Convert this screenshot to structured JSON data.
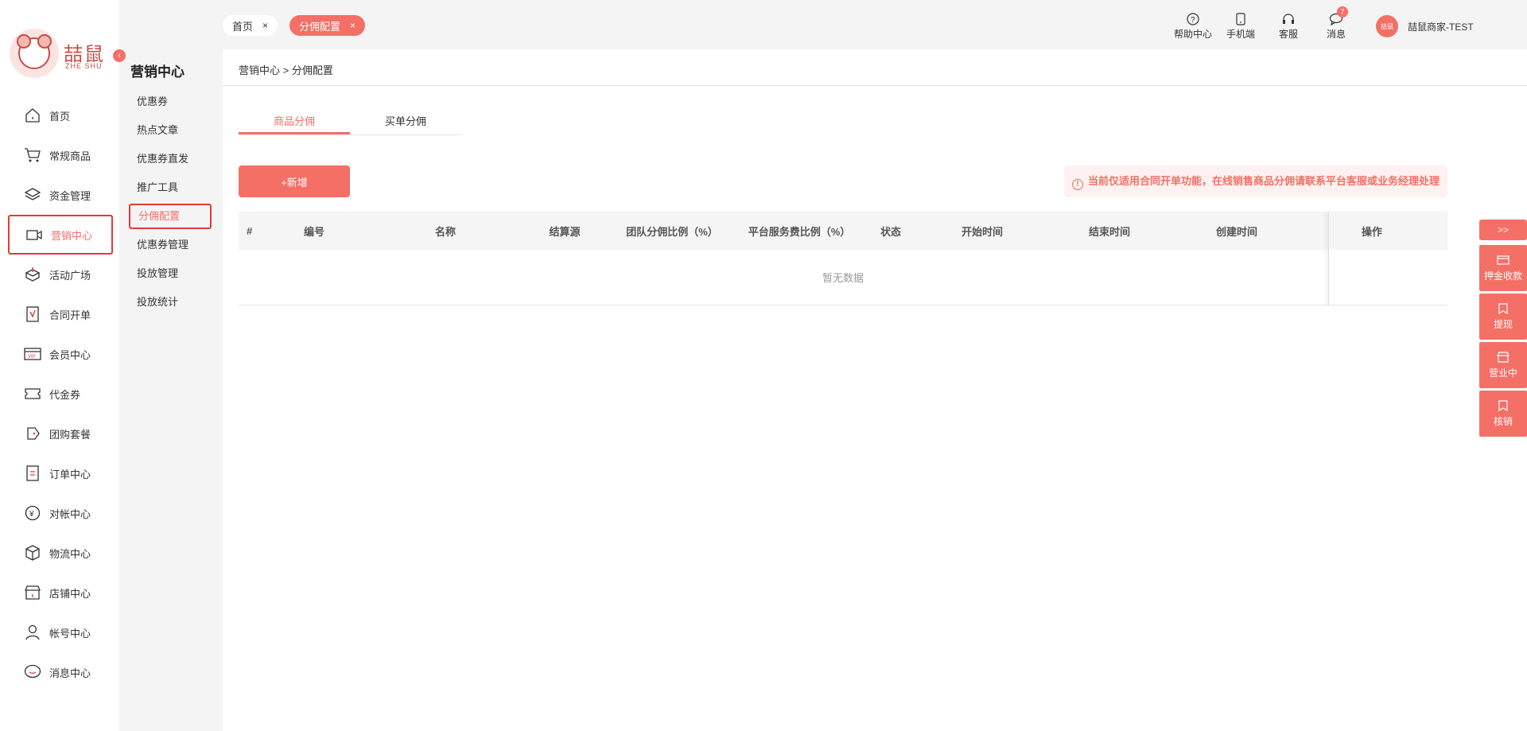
{
  "logo": {
    "text": "喆鼠",
    "sub": "ZHE SHU"
  },
  "nav": [
    {
      "label": "首页",
      "icon": "home-icon"
    },
    {
      "label": "常规商品",
      "icon": "cart-icon"
    },
    {
      "label": "资金管理",
      "icon": "layers-icon"
    },
    {
      "label": "营销中心",
      "icon": "camera-icon"
    },
    {
      "label": "活动广场",
      "icon": "box-upload-icon"
    },
    {
      "label": "合同开单",
      "icon": "contract-icon"
    },
    {
      "label": "会员中心",
      "icon": "vip-card-icon"
    },
    {
      "label": "代金券",
      "icon": "voucher-icon"
    },
    {
      "label": "团购套餐",
      "icon": "tag-icon"
    },
    {
      "label": "订单中心",
      "icon": "order-icon"
    },
    {
      "label": "对帐中心",
      "icon": "yen-icon"
    },
    {
      "label": "物流中心",
      "icon": "package-icon"
    },
    {
      "label": "店铺中心",
      "icon": "store-icon"
    },
    {
      "label": "帐号中心",
      "icon": "user-icon"
    },
    {
      "label": "消息中心",
      "icon": "message-icon"
    }
  ],
  "sub": {
    "title": "营销中心",
    "items": [
      "优惠券",
      "热点文章",
      "优惠券直发",
      "推广工具",
      "分佣配置",
      "优惠券管理",
      "投放管理",
      "投放统计"
    ]
  },
  "tabs": [
    {
      "label": "首页",
      "close": "×"
    },
    {
      "label": "分佣配置",
      "close": "×"
    }
  ],
  "topbar": {
    "help": "帮助中心",
    "mobile": "手机端",
    "service": "客服",
    "message": "消息",
    "message_count": "7",
    "avatar_text": "喆鼠",
    "user": "喆鼠商家-TEST"
  },
  "breadcrumb": {
    "parent": "营销中心",
    "sep": ">",
    "current": "分佣配置"
  },
  "page_tabs": [
    "商品分佣",
    "买单分佣"
  ],
  "add_button": "+新增",
  "notice": "当前仅适用合同开单功能，在线销售商品分佣请联系平台客服或业务经理处理",
  "notice_icon": "!",
  "table": {
    "columns": [
      "#",
      "编号",
      "名称",
      "结算源",
      "团队分佣比例（%）",
      "平台服务费比例（%）",
      "状态",
      "开始时间",
      "结束时间",
      "创建时间",
      "操作"
    ],
    "empty": "暂无数据"
  },
  "float": {
    "toggle": ">>",
    "items": [
      {
        "label": "押金收款",
        "icon": "card-icon"
      },
      {
        "label": "提现",
        "icon": "bookmark-icon"
      },
      {
        "label": "营业中",
        "icon": "shop-icon"
      },
      {
        "label": "核销",
        "icon": "check-icon"
      }
    ]
  },
  "colors": {
    "accent": "#f46f66",
    "active_border": "#e53935"
  }
}
